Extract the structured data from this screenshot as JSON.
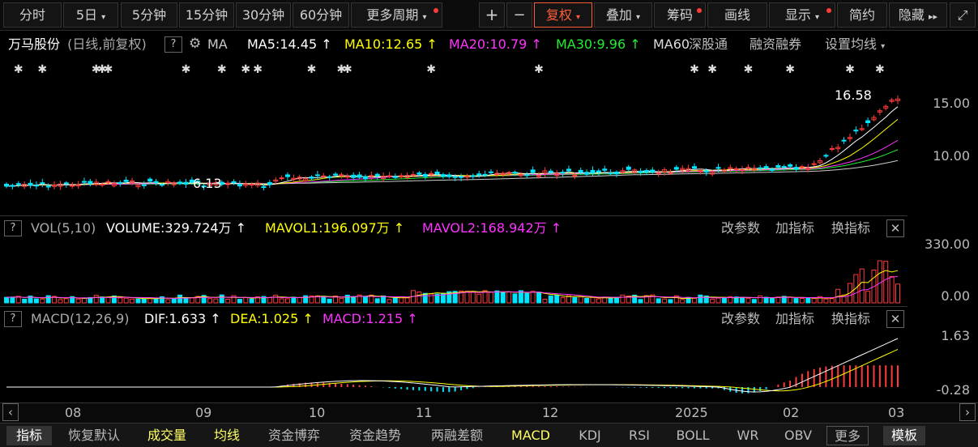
{
  "toolbar": {
    "fenshi": "分时",
    "day5": "5日",
    "min5": "5分钟",
    "min15": "15分钟",
    "min30": "30分钟",
    "min60": "60分钟",
    "more_period": "更多周期",
    "plus": "+",
    "minus": "−",
    "fuquan": "复权",
    "diejia": "叠加",
    "chouma": "筹码",
    "huaxian": "画线",
    "xianshi": "显示",
    "jianyue": "简约",
    "yincang": "隐藏"
  },
  "colors": {
    "red": "#ff3b3b",
    "cyan": "#00e5ff",
    "white": "#ffffff",
    "yellow": "#ffff00",
    "magenta": "#ff33ff",
    "green": "#22ee33",
    "accent": "#ff5c3a"
  },
  "price_panel": {
    "stock_name": "万马股份",
    "period": "(日线,前复权)",
    "ma_label": "MA",
    "ma5": "MA5:14.45",
    "ma10": "MA10:12.65",
    "ma20": "MA20:10.79",
    "ma30": "MA30:9.96",
    "ma60": "MA60",
    "shengutong": "深股通",
    "rongzi": "融资融券",
    "shezhi": "设置均线",
    "high_label": "16.58",
    "low_label": "6.13",
    "y_labels": [
      "15.00",
      "10.00"
    ]
  },
  "vol_panel": {
    "title": "VOL(5,10)",
    "volume": "VOLUME:329.724万",
    "mavol1": "MAVOL1:196.097万",
    "mavol2": "MAVOL2:168.942万",
    "gaicanshu": "改参数",
    "jiazhibiao": "加指标",
    "huanzhibiao": "换指标",
    "y_labels": [
      "330.00",
      "0.00"
    ]
  },
  "macd_panel": {
    "title": "MACD(12,26,9)",
    "dif": "DIF:1.633",
    "dea": "DEA:1.025",
    "macd": "MACD:1.215",
    "gaicanshu": "改参数",
    "jiazhibiao": "加指标",
    "huanzhibiao": "换指标",
    "y_labels": [
      "1.63",
      "-0.28"
    ]
  },
  "time_axis": [
    "08",
    "09",
    "10",
    "11",
    "12",
    "2025",
    "02",
    "03"
  ],
  "bottom_tabs": [
    "指标",
    "恢复默认",
    "成交量",
    "均线",
    "资金博弈",
    "资金趋势",
    "两融差额",
    "MACD",
    "KDJ",
    "RSI",
    "BOLL",
    "WR",
    "OBV",
    "更多",
    "模板"
  ]
}
